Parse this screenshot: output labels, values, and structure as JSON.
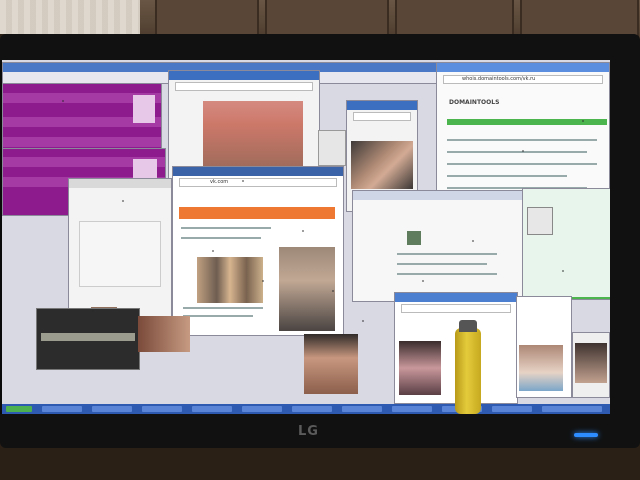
{
  "room": {
    "monitor_brand": "LG"
  },
  "screen_windows": {
    "browser_top_right": {
      "url": "whois.domaintools.com/vk.ru",
      "brand": "DOMAINTOOLS"
    },
    "browser_center": {
      "url": "vk.com"
    }
  },
  "colors": {
    "magenta_window": "#8e1b8e",
    "taskbar": "#2e5bb1",
    "orange_bar": "#ee7732",
    "green_bar": "#4db54d",
    "led": "#2d8cff",
    "lighter": "#e3cb3b"
  }
}
